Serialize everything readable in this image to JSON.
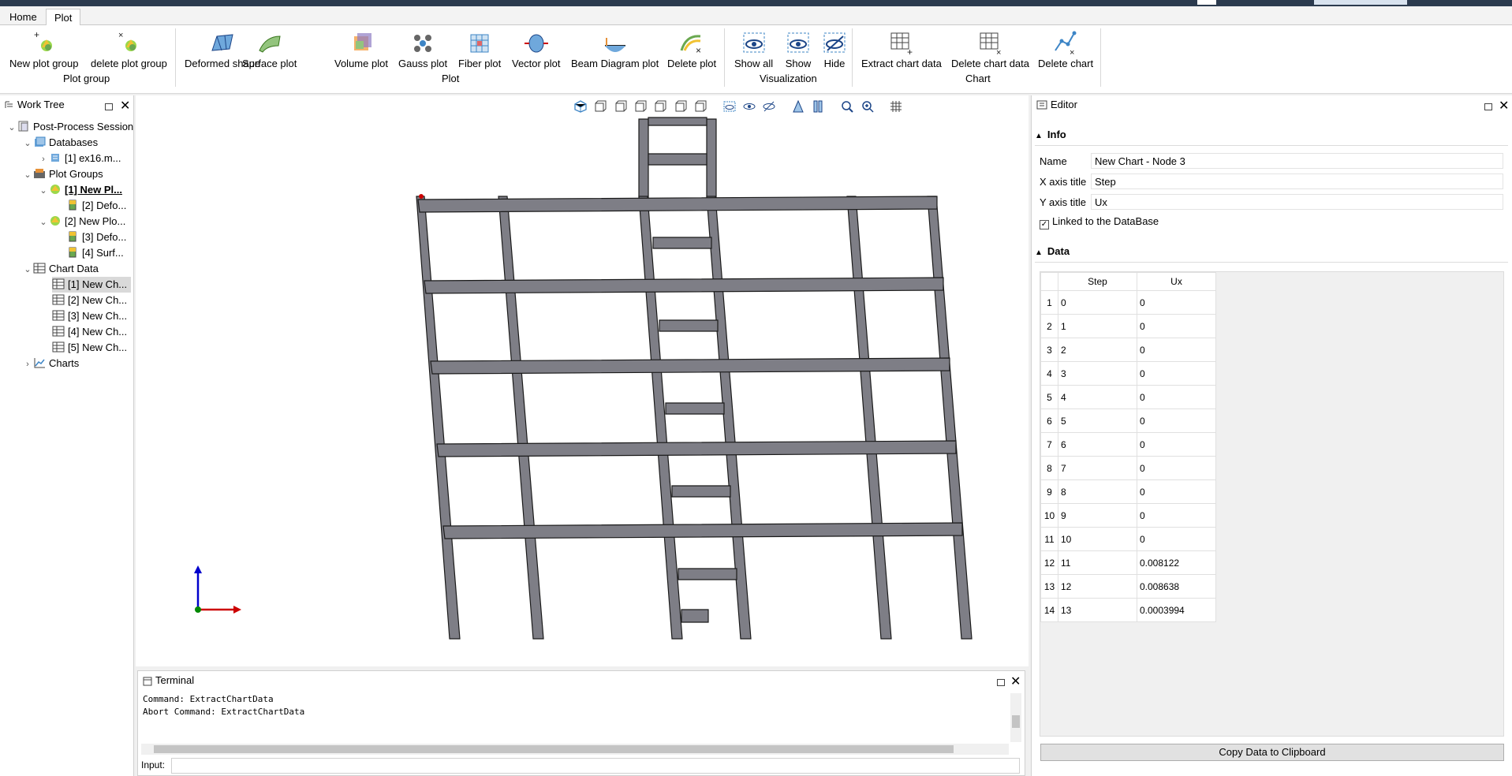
{
  "tabs": [
    {
      "label": "Home"
    },
    {
      "label": "Plot"
    }
  ],
  "ribbon": {
    "buttons": [
      {
        "label": "New plot group",
        "icon": "new-plot-group-icon"
      },
      {
        "label": "delete plot group",
        "icon": "delete-plot-group-icon"
      },
      {
        "label": "Deformed shape",
        "icon": "deformed-shape-icon"
      },
      {
        "label": "Surface plot",
        "icon": "surface-plot-icon"
      },
      {
        "label": "Volume plot",
        "icon": "volume-plot-icon"
      },
      {
        "label": "Gauss plot",
        "icon": "gauss-plot-icon"
      },
      {
        "label": "Fiber plot",
        "icon": "fiber-plot-icon"
      },
      {
        "label": "Vector plot",
        "icon": "vector-plot-icon"
      },
      {
        "label": "Beam Diagram plot",
        "icon": "beam-diagram-icon"
      },
      {
        "label": "Delete plot",
        "icon": "delete-plot-icon"
      },
      {
        "label": "Show all",
        "icon": "show-all-icon"
      },
      {
        "label": "Show",
        "icon": "show-icon"
      },
      {
        "label": "Hide",
        "icon": "hide-icon"
      },
      {
        "label": "Extract chart data",
        "icon": "extract-chart-data-icon"
      },
      {
        "label": "Delete chart data",
        "icon": "delete-chart-data-icon"
      },
      {
        "label": "Delete chart",
        "icon": "delete-chart-icon"
      }
    ],
    "groups": [
      "Plot group",
      "Plot",
      "Visualization",
      "Chart"
    ]
  },
  "worktree": {
    "title": "Work Tree",
    "items": [
      {
        "label": "Post-Process Session"
      },
      {
        "label": "Databases"
      },
      {
        "label": "[1] ex16.m..."
      },
      {
        "label": "Plot Groups"
      },
      {
        "label": "[1] New Pl..."
      },
      {
        "label": "[2] Defo..."
      },
      {
        "label": "[2] New Plo..."
      },
      {
        "label": "[3] Defo..."
      },
      {
        "label": "[4] Surf..."
      },
      {
        "label": "Chart Data"
      },
      {
        "label": "[1] New Ch..."
      },
      {
        "label": "[2] New Ch..."
      },
      {
        "label": "[3] New Ch..."
      },
      {
        "label": "[4] New Ch..."
      },
      {
        "label": "[5] New Ch..."
      },
      {
        "label": "Charts"
      }
    ]
  },
  "terminal": {
    "title": "Terminal",
    "lines": [
      "Command: ExtractChartData",
      "Abort Command: ExtractChartData"
    ],
    "input_label": "Input:",
    "input_value": ""
  },
  "editor": {
    "title": "Editor",
    "info_header": "Info",
    "name_label": "Name",
    "name_value": "New Chart - Node 3",
    "xaxis_label": "X axis title",
    "xaxis_value": "Step",
    "yaxis_label": "Y axis title",
    "yaxis_value": "Ux",
    "linked_label": "Linked to the DataBase",
    "linked_checked": true,
    "data_header": "Data",
    "columns": [
      "Step",
      "Ux"
    ],
    "rows": [
      [
        "1",
        "0",
        "0"
      ],
      [
        "2",
        "1",
        "0"
      ],
      [
        "3",
        "2",
        "0"
      ],
      [
        "4",
        "3",
        "0"
      ],
      [
        "5",
        "4",
        "0"
      ],
      [
        "6",
        "5",
        "0"
      ],
      [
        "7",
        "6",
        "0"
      ],
      [
        "8",
        "7",
        "0"
      ],
      [
        "9",
        "8",
        "0"
      ],
      [
        "10",
        "9",
        "0"
      ],
      [
        "11",
        "10",
        "0"
      ],
      [
        "12",
        "11",
        "0.008122"
      ],
      [
        "13",
        "12",
        "0.008638"
      ],
      [
        "14",
        "13",
        "0.0003994"
      ]
    ],
    "copy_button": "Copy Data to Clipboard"
  },
  "colors": {
    "accent": "#2b3a4e",
    "frame_fill": "#7e7e86",
    "axis_x": "#cc0000",
    "axis_y": "#0000cc",
    "axis_z": "#008800"
  }
}
